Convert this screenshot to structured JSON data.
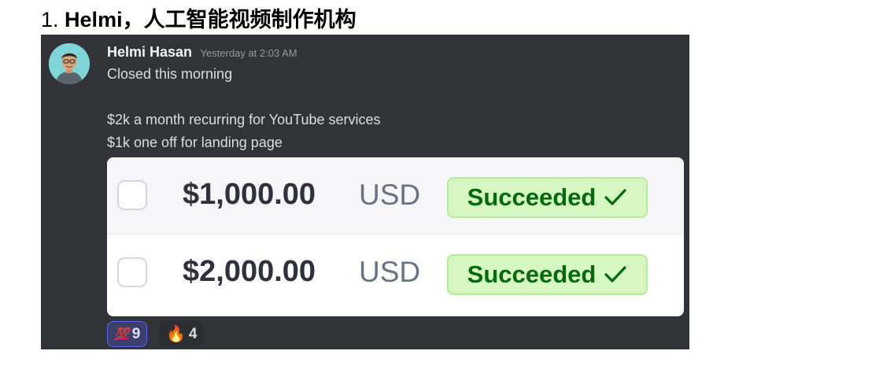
{
  "heading": {
    "number": "1.",
    "title": "Helmi，人工智能视频制作机构"
  },
  "message": {
    "author": "Helmi Hasan",
    "timestamp": "Yesterday at 2:03 AM",
    "lines": [
      "Closed this morning",
      "$2k a month recurring for YouTube services",
      "$1k one off for landing page"
    ]
  },
  "payments": [
    {
      "amount": "$1,000.00",
      "currency": "USD",
      "status": "Succeeded"
    },
    {
      "amount": "$2,000.00",
      "currency": "USD",
      "status": "Succeeded"
    }
  ],
  "reactions": [
    {
      "emoji": "hundred-points",
      "glyph": "💯",
      "count": "9",
      "active": true
    },
    {
      "emoji": "fire",
      "glyph": "🔥",
      "count": "4",
      "active": false
    }
  ],
  "colors": {
    "discord_bg": "#313338",
    "success_bg": "#d7f7c2",
    "success_text": "#05690d",
    "reaction_active": "#5865f2"
  }
}
